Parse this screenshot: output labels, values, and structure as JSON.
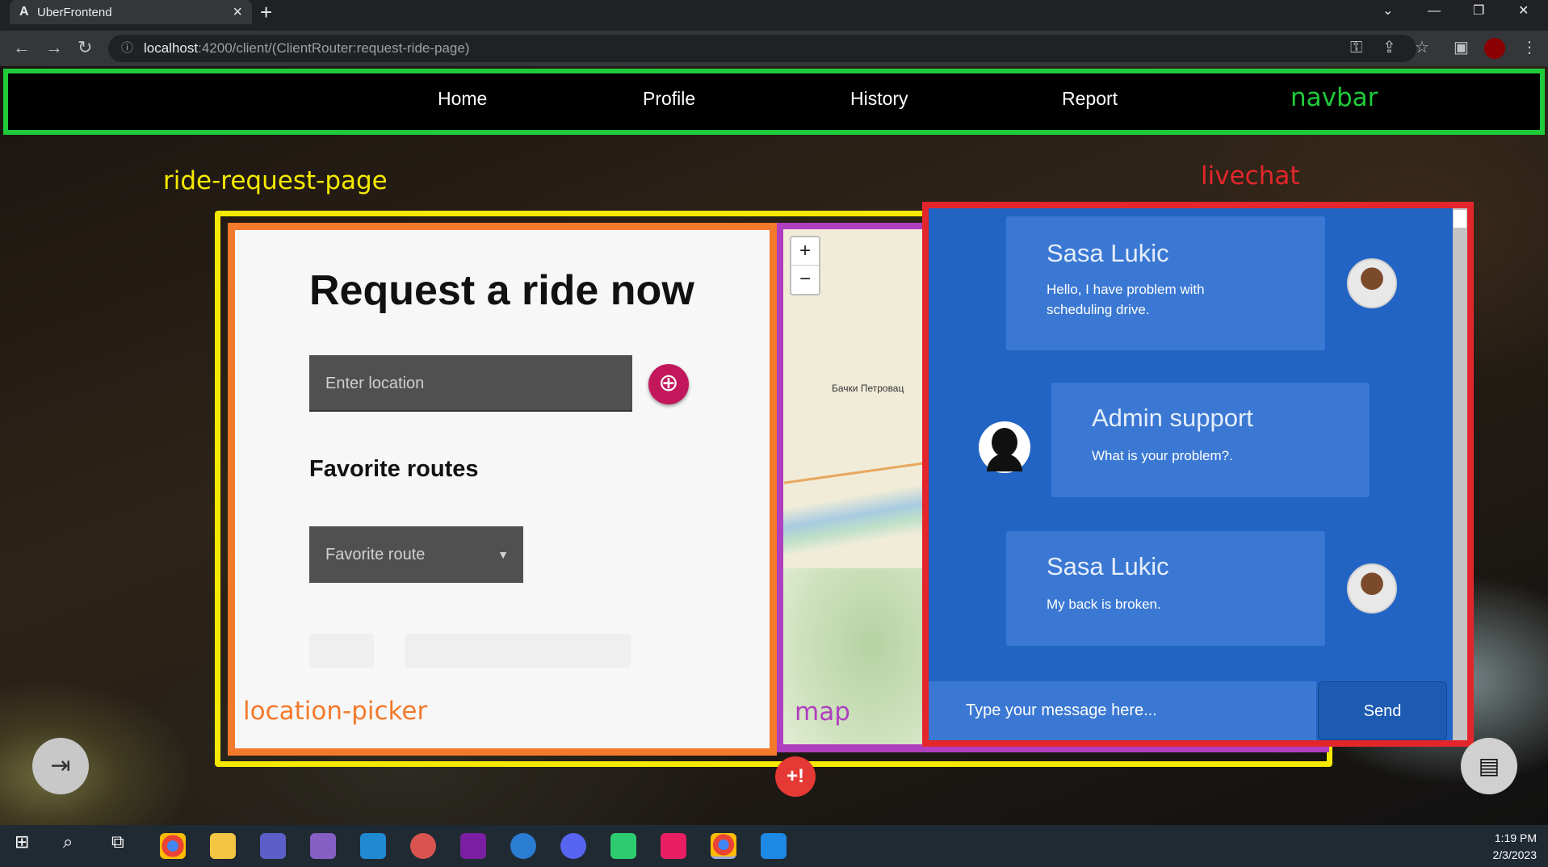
{
  "browser": {
    "tab_title": "UberFrontend",
    "tab_favicon": "A",
    "url_host": "localhost",
    "url_rest": ":4200/client/(ClientRouter:request-ride-page)"
  },
  "navbar": {
    "links": [
      "Home",
      "Profile",
      "History",
      "Report"
    ]
  },
  "annotations": {
    "navbar": "navbar",
    "ride_request_page": "ride-request-page",
    "livechat": "livechat",
    "location_picker": "location-picker",
    "map": "map",
    "colors": {
      "navbar": "#1fcb3b",
      "ride_request_page": "#f5e900",
      "livechat": "#e3262b",
      "location_picker": "#f3792b",
      "map": "#b03fbf"
    }
  },
  "location_picker": {
    "title": "Request a ride now",
    "location_placeholder": "Enter location",
    "favorite_routes_title": "Favorite routes",
    "favorite_route_placeholder": "Favorite route"
  },
  "map": {
    "place_label": "Бачки Петровац",
    "zoom_in": "+",
    "zoom_out": "−"
  },
  "livechat": {
    "messages": [
      {
        "name": "Sasa Lukic",
        "text": "Hello, I have problem with scheduling drive."
      },
      {
        "name": "Admin support",
        "text": "What is your problem?."
      },
      {
        "name": "Sasa Lukic",
        "text": "My back is broken."
      }
    ],
    "input_placeholder": "Type your message here...",
    "send_label": "Send"
  },
  "clock": {
    "time": "1:19 PM",
    "date": "2/3/2023"
  }
}
